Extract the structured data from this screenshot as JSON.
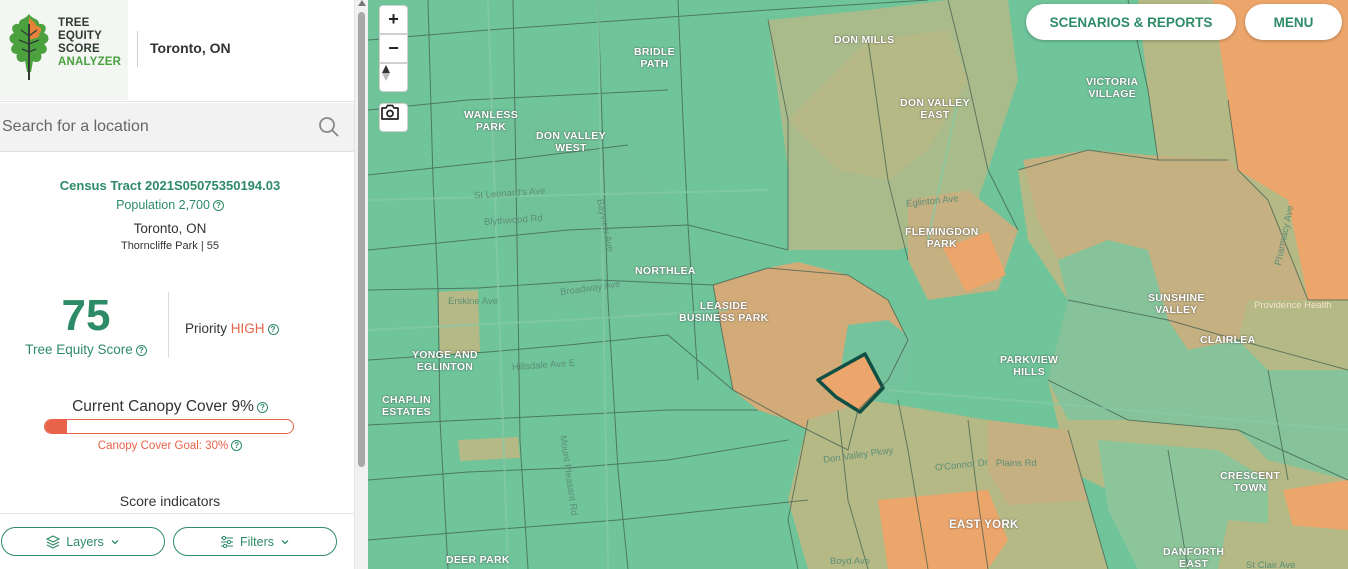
{
  "header": {
    "logo_lines": [
      "TREE",
      "EQUITY",
      "SCORE",
      "ANALYZER"
    ],
    "city": "Toronto, ON"
  },
  "search": {
    "placeholder": "Search for a location"
  },
  "tract": {
    "name": "Census Tract 2021S05075350194.03",
    "population": "Population 2,700",
    "city": "Toronto, ON",
    "neighbourhood": "Thorncliffe Park | 55"
  },
  "score": {
    "value": "75",
    "label": "Tree Equity Score",
    "priority_label": "Priority",
    "priority_value": "HIGH"
  },
  "canopy": {
    "title": "Current Canopy Cover 9%",
    "percent": 9,
    "goal_percent": 30,
    "goal_label": "Canopy Cover Goal: 30%"
  },
  "indicators": {
    "title": "Score indicators"
  },
  "controls": {
    "layers_label": "Layers",
    "filters_label": "Filters"
  },
  "map": {
    "zoom_in": "+",
    "zoom_out": "−",
    "scenarios_label": "SCENARIOS & REPORTS",
    "menu_label": "MENU",
    "neighbourhoods": [
      "BRIDLE\nPATH",
      "DON MILLS",
      "VICTORIA\nVILLAGE",
      "WANLESS\nPARK",
      "DON VALLEY\nWEST",
      "DON VALLEY\nEAST",
      "FLEMINGDON\nPARK",
      "NORTHLEA",
      "LEASIDE\nBUSINESS PARK",
      "SUNSHINE\nVALLEY",
      "CLAIRLEA",
      "YONGE AND\nEGLINTON",
      "PARKVIEW\nHILLS",
      "CHAPLIN\nESTATES",
      "CRESCENT\nTOWN",
      "EAST YORK",
      "DEER PARK",
      "DANFORTH\nEAST"
    ],
    "streets": [
      "St Leonard's Ave",
      "Blythwood Rd",
      "Broadway Ave",
      "Erskine Ave",
      "Hillsdale Ave E",
      "Eglinton Ave",
      "Bayview Ave",
      "Pharmacy Ave",
      "O'Connor Dr",
      "Plains Rd",
      "Don Valley Pkwy",
      "Providence Health",
      "Boyd Ave",
      "St Clair Ave",
      "Mount Pleasant Rd"
    ],
    "colors": {
      "green": "#6fc49a",
      "light_green": "#8cc59a",
      "olive": "#b5b985",
      "tan": "#d2ab79",
      "orange": "#eca56a",
      "highlight": "#104f43"
    }
  }
}
